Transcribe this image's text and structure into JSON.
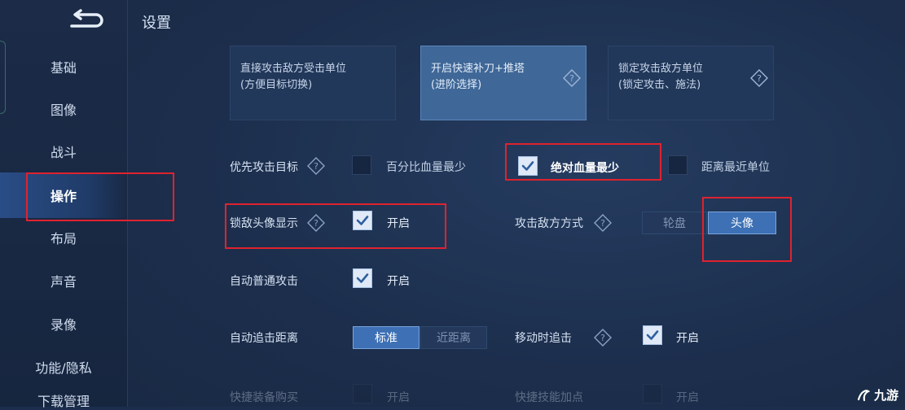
{
  "page_title": "设置",
  "sidebar": {
    "items": [
      {
        "label": "基础"
      },
      {
        "label": "图像"
      },
      {
        "label": "战斗"
      },
      {
        "label": "操作"
      },
      {
        "label": "布局"
      },
      {
        "label": "声音"
      },
      {
        "label": "录像"
      },
      {
        "label": "功能/隐私"
      },
      {
        "label": "下载管理"
      }
    ]
  },
  "cards": [
    {
      "line1": "直接攻击敌方受击单位",
      "line2": "(方便目标切换)"
    },
    {
      "line1": "开启快速补刀+推塔",
      "line2": "(进阶选择)"
    },
    {
      "line1": "锁定攻击敌方单位",
      "line2": "(锁定攻击、施法)"
    }
  ],
  "settings": {
    "priority_target": {
      "label": "优先攻击目标",
      "options": [
        "百分比血量最少",
        "绝对血量最少",
        "距离最近单位"
      ]
    },
    "lock_avatar": {
      "label": "锁敌头像显示",
      "option": "开启"
    },
    "attack_mode": {
      "label": "攻击敌方方式",
      "options": [
        "轮盘",
        "头像"
      ]
    },
    "auto_attack": {
      "label": "自动普通攻击",
      "option": "开启"
    },
    "auto_chase": {
      "label": "自动追击距离",
      "options": [
        "标准",
        "近距离"
      ]
    },
    "move_chase": {
      "label": "移动时追击",
      "option": "开启"
    },
    "partial_row": {
      "left": "快捷装备购买",
      "left_option": "开启",
      "right": "快捷技能加点",
      "right_option": "开启"
    }
  },
  "watermark": "九游"
}
